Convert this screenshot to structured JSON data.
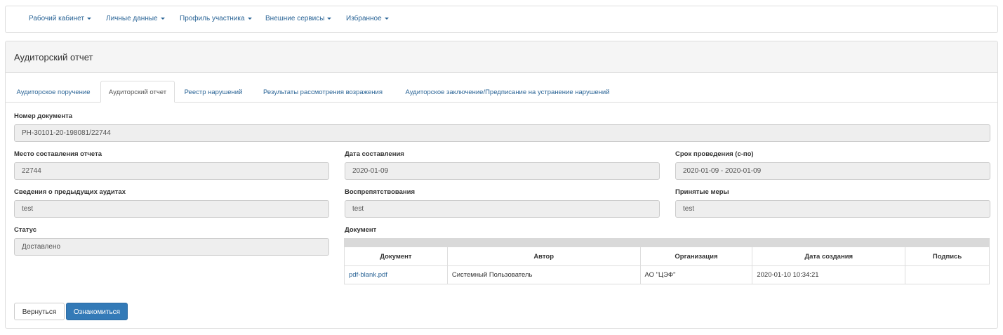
{
  "navbar": {
    "items": [
      {
        "label": "Рабочий кабинет"
      },
      {
        "label": "Личные данные"
      },
      {
        "label": "Профиль участника"
      },
      {
        "label": "Внешние сервисы"
      },
      {
        "label": "Избранное"
      }
    ]
  },
  "panel": {
    "title": "Аудиторский отчет"
  },
  "tabs": [
    {
      "label": "Аудиторское поручение",
      "active": false
    },
    {
      "label": "Аудиторский отчет",
      "active": true
    },
    {
      "label": "Реестр нарушений",
      "active": false
    },
    {
      "label": "Результаты рассмотрения возражения",
      "active": false
    },
    {
      "label": "Аудиторское заключение/Предписание на устранение нарушений",
      "active": false
    }
  ],
  "form": {
    "doc_number": {
      "label": "Номер документа",
      "value": "PH-30101-20-198081/22744"
    },
    "place": {
      "label": "Место составления отчета",
      "value": "22744"
    },
    "date": {
      "label": "Дата составления",
      "value": "2020-01-09"
    },
    "period": {
      "label": "Срок проведения (с-по)",
      "value": "2020-01-09 - 2020-01-09"
    },
    "prev_audits": {
      "label": "Сведения о предыдущих аудитах",
      "value": "test"
    },
    "obstructions": {
      "label": "Воспрепятствования",
      "value": "test"
    },
    "measures": {
      "label": "Принятые меры",
      "value": "test"
    },
    "status": {
      "label": "Статус",
      "value": "Доставлено"
    }
  },
  "documents": {
    "label": "Документ",
    "columns": [
      "Документ",
      "Автор",
      "Организация",
      "Дата создания",
      "Подпись"
    ],
    "rows": [
      {
        "file": "pdf-blank.pdf",
        "author": "Системный Пользователь",
        "org": "АО \"ЦЭФ\"",
        "created": "2020-01-10 10:34:21",
        "signature": ""
      }
    ]
  },
  "buttons": {
    "back": "Вернуться",
    "acknowledge": "Ознакомиться"
  },
  "colors": {
    "link": "#2a6496",
    "primary": "#337ab7",
    "field_bg": "#eeeeee",
    "heading_bg": "#f5f5f5"
  }
}
